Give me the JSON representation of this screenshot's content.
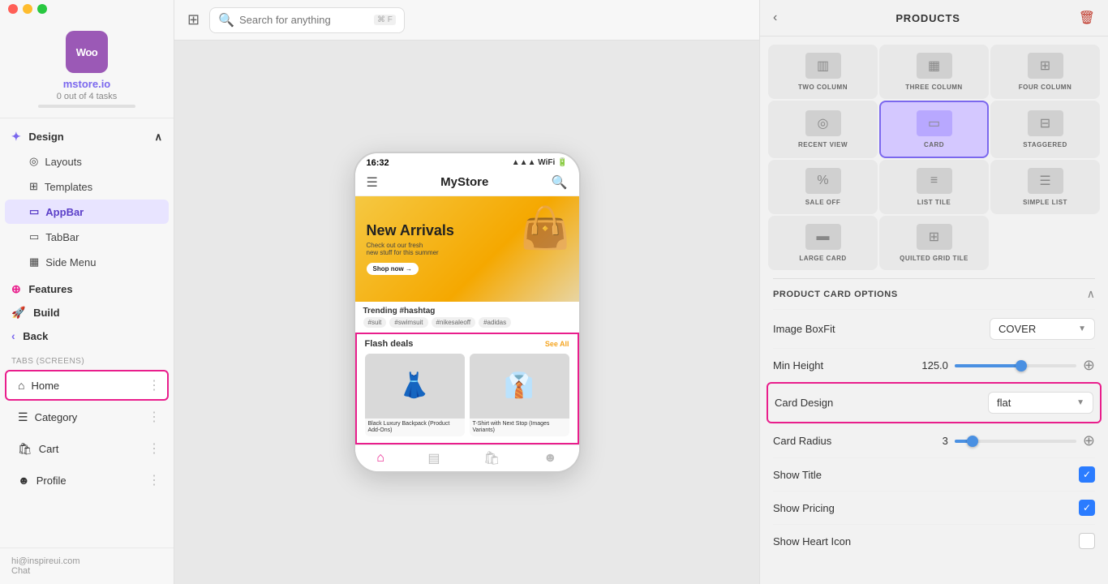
{
  "app": {
    "store_name": "mstore.io",
    "tasks_text": "0 out of 4 tasks",
    "logo_text": "Woo"
  },
  "titlebar": {
    "close_label": "close",
    "minimize_label": "minimize",
    "maximize_label": "maximize"
  },
  "topbar": {
    "search_placeholder": "Search for anything",
    "search_shortcut": "⌘ F"
  },
  "sidebar": {
    "design_label": "Design",
    "nav_items": [
      {
        "label": "Layouts",
        "icon": "◎",
        "active": false
      },
      {
        "label": "Templates",
        "icon": "⊞",
        "active": false
      },
      {
        "label": "AppBar",
        "icon": "▭",
        "active": true
      },
      {
        "label": "TabBar",
        "icon": "▭",
        "active": false
      },
      {
        "label": "Side Menu",
        "icon": "▦",
        "active": false
      }
    ],
    "features_label": "Features",
    "build_label": "Build",
    "back_label": "Back",
    "tabs_section_label": "Tabs (screens)",
    "tabs": [
      {
        "label": "Home",
        "icon": "⌂",
        "active": true
      },
      {
        "label": "Category",
        "icon": "☰",
        "active": false
      },
      {
        "label": "Cart",
        "icon": "🛍",
        "active": false
      },
      {
        "label": "Profile",
        "icon": "☻",
        "active": false
      }
    ],
    "footer_email": "hi@inspireui.com",
    "chat_label": "Chat"
  },
  "phone": {
    "time": "16:32",
    "store_title": "MyStore",
    "banner_title": "New Arrivals",
    "banner_sub": "Check out our fresh\nnew stuff for this summer",
    "banner_btn": "Shop now →",
    "section_trending": "Trending #hashtag",
    "hashtags": [
      "#suit",
      "#swimsuit",
      "#nikesaleoff",
      "#adidas"
    ],
    "flash_deals_title": "Flash deals",
    "see_all": "See All",
    "products": [
      {
        "name": "Black Luxury Backpack\n(Product Add-Ons)"
      },
      {
        "name": "T-Shirt with Next Stop\n(Images Variants)"
      }
    ]
  },
  "right_panel": {
    "title": "PRODUCTS",
    "product_types": [
      {
        "label": "TWO COLUMN",
        "icon": "▥"
      },
      {
        "label": "THREE COLUMN",
        "icon": "▦"
      },
      {
        "label": "FOUR COLUMN",
        "icon": "▦"
      },
      {
        "label": "RECENT VIEW",
        "icon": "◎"
      },
      {
        "label": "CARD",
        "icon": "▭",
        "selected": true
      },
      {
        "label": "STAGGERED",
        "icon": "⊞"
      },
      {
        "label": "SALE OFF",
        "icon": "%"
      },
      {
        "label": "LIST TILE",
        "icon": "≡"
      },
      {
        "label": "SIMPLE LIST",
        "icon": "☰"
      },
      {
        "label": "LARGE CARD",
        "icon": "▭"
      },
      {
        "label": "QUILTED GRID TILE",
        "icon": "⊟"
      }
    ],
    "options_title": "PRODUCT CARD OPTIONS",
    "options": [
      {
        "type": "select",
        "label": "Image BoxFit",
        "value": "COVER"
      },
      {
        "type": "slider",
        "label": "Min Height",
        "value": "125.0",
        "fill_percent": 55
      },
      {
        "type": "select",
        "label": "Card Design",
        "value": "flat",
        "highlighted": true
      },
      {
        "type": "slider",
        "label": "Card Radius",
        "value": "3",
        "fill_percent": 15
      },
      {
        "type": "checkbox",
        "label": "Show Title",
        "checked": true
      },
      {
        "type": "checkbox",
        "label": "Show Pricing",
        "checked": true
      },
      {
        "type": "checkbox",
        "label": "Show Heart Icon",
        "checked": false
      }
    ]
  }
}
